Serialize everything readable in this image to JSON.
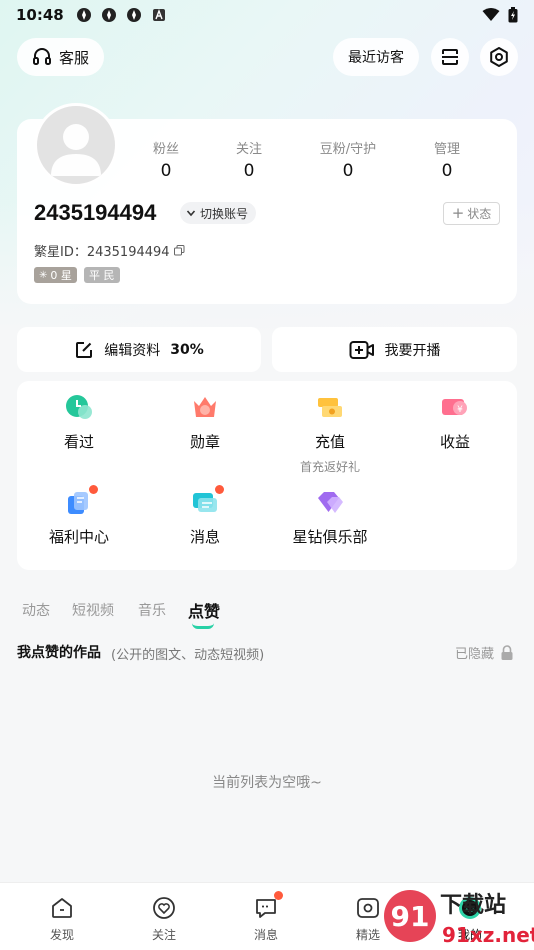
{
  "status_bar": {
    "time": "10:48"
  },
  "top_bar": {
    "service_label": "客服",
    "visitors_label": "最近访客"
  },
  "profile": {
    "stats": [
      {
        "label": "粉丝",
        "value": "0"
      },
      {
        "label": "关注",
        "value": "0"
      },
      {
        "label": "豆粉/守护",
        "value": "0"
      },
      {
        "label": "管理",
        "value": "0"
      }
    ],
    "user_id": "2435194494",
    "switch_account_label": "切换账号",
    "status_label": "状态",
    "fanxing_id_label": "繁星ID：2435194494",
    "star_badge": "0 星",
    "rank_badge": "平 民"
  },
  "actions": {
    "edit_profile": "编辑资料",
    "edit_percent": "30%",
    "go_live": "我要开播"
  },
  "grid": [
    {
      "label": "看过",
      "sub": "",
      "icon": "clock-icon"
    },
    {
      "label": "勋章",
      "sub": "",
      "icon": "medal-icon"
    },
    {
      "label": "充值",
      "sub": "首充返好礼",
      "icon": "recharge-icon"
    },
    {
      "label": "收益",
      "sub": "",
      "icon": "income-icon"
    },
    {
      "label": "福利中心",
      "sub": "",
      "icon": "welfare-icon"
    },
    {
      "label": "消息",
      "sub": "",
      "icon": "message-icon"
    },
    {
      "label": "星钻俱乐部",
      "sub": "",
      "icon": "diamond-icon"
    }
  ],
  "tabs": [
    "动态",
    "短视频",
    "音乐",
    "点赞"
  ],
  "liked": {
    "title": "我点赞的作品",
    "subtitle": "(公开的图文、动态短视频)",
    "hidden_label": "已隐藏",
    "empty_text": "当前列表为空哦~"
  },
  "nav": [
    "发现",
    "关注",
    "消息",
    "精选",
    "我的"
  ],
  "colors": {
    "accent": "#28d1a6",
    "badge_dot": "#ff5a3c"
  }
}
